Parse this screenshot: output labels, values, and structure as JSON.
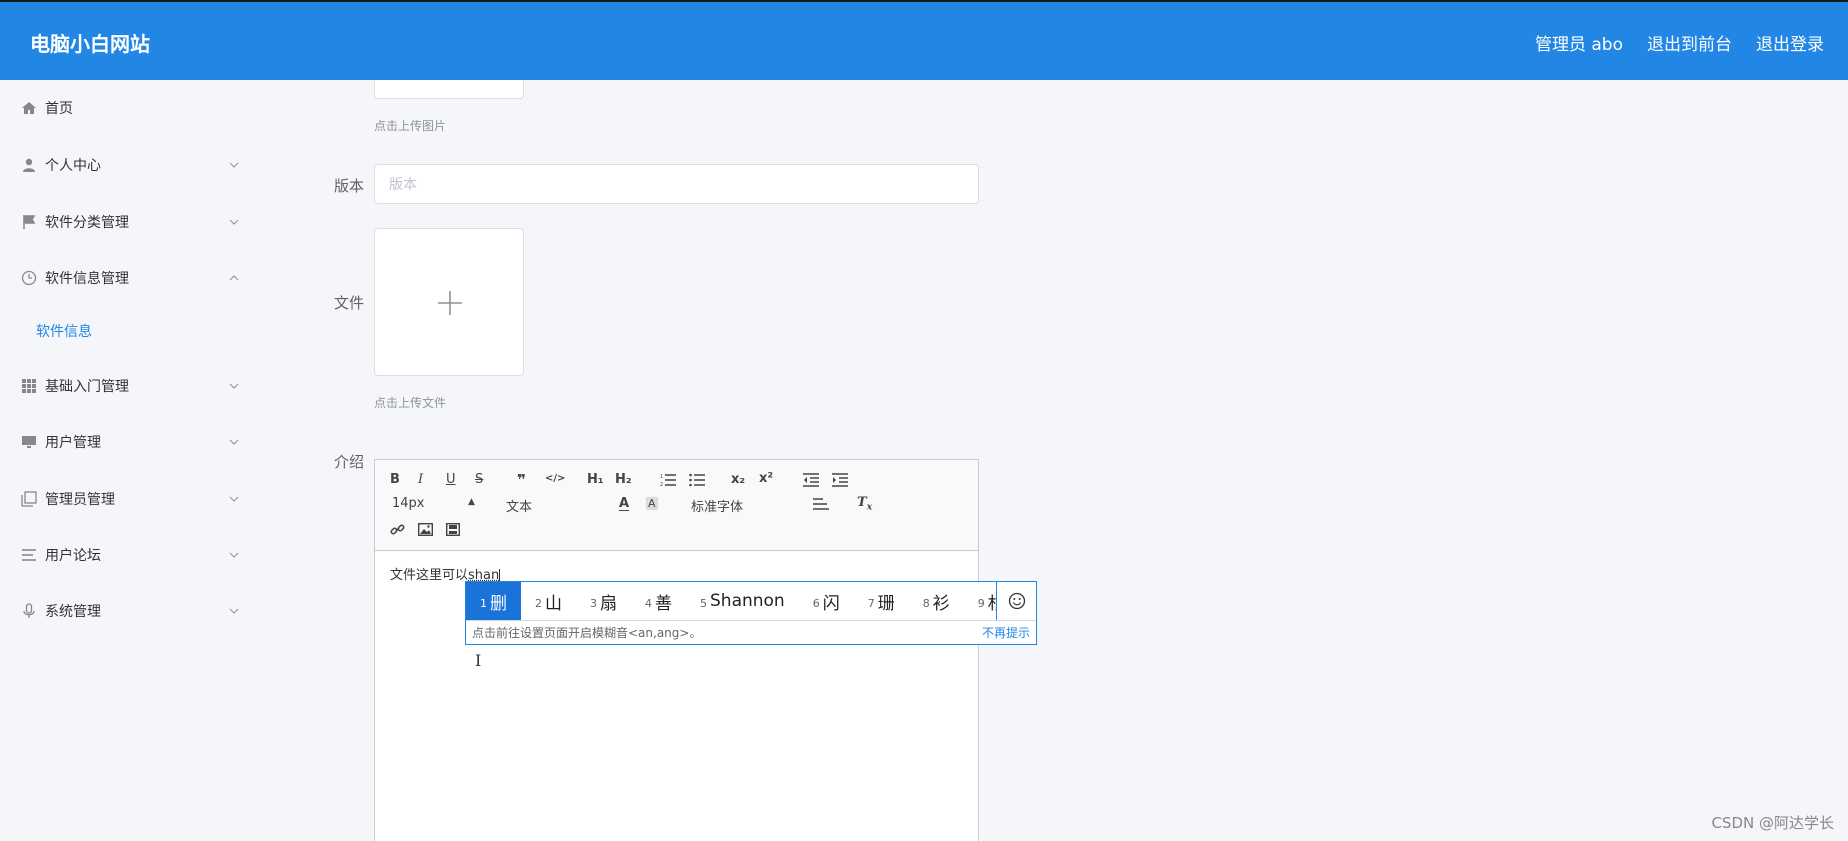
{
  "header": {
    "logo": "电脑小白网站",
    "admin": "管理员 abo",
    "to_front": "退出到前台",
    "logout": "退出登录"
  },
  "sidebar": {
    "items": [
      {
        "label": "首页",
        "icon": "home-icon"
      },
      {
        "label": "个人中心",
        "icon": "user-icon"
      },
      {
        "label": "软件分类管理",
        "icon": "flag-icon"
      },
      {
        "label": "软件信息管理",
        "icon": "clock-icon"
      },
      {
        "label": "基础入门管理",
        "icon": "grid-icon"
      },
      {
        "label": "用户管理",
        "icon": "monitor-icon"
      },
      {
        "label": "管理员管理",
        "icon": "copy-icon"
      },
      {
        "label": "用户论坛",
        "icon": "list-icon"
      },
      {
        "label": "系统管理",
        "icon": "mic-icon"
      }
    ],
    "sub_item": "软件信息"
  },
  "form": {
    "image_hint": "点击上传图片",
    "version_label": "版本",
    "version_placeholder": "版本",
    "file_label": "文件",
    "file_hint": "点击上传文件",
    "intro_label": "介绍"
  },
  "editor": {
    "toolbar": {
      "bold": "B",
      "italic": "I",
      "underline": "U",
      "strike": "S",
      "quote": "❞",
      "code": "</>",
      "h1": "H₁",
      "h2": "H₂",
      "sub": "x₂",
      "sup": "x²",
      "font_size": "14px",
      "block_type": "文本",
      "font_family": "标准字体",
      "color": "A",
      "bg_color": "A",
      "clear": "T"
    },
    "content": "文件这里可以",
    "typed": "shan"
  },
  "ime": {
    "candidates": [
      {
        "num": "1",
        "text": "删"
      },
      {
        "num": "2",
        "text": "山"
      },
      {
        "num": "3",
        "text": "扇"
      },
      {
        "num": "4",
        "text": "善"
      },
      {
        "num": "5",
        "text": "Shannon"
      },
      {
        "num": "6",
        "text": "闪"
      },
      {
        "num": "7",
        "text": "珊"
      },
      {
        "num": "8",
        "text": "衫"
      },
      {
        "num": "9",
        "text": "杉"
      }
    ],
    "tip": "点击前往设置页面开启模糊音<an,ang>。",
    "no_more": "不再提示"
  },
  "watermark": "CSDN @阿达学长",
  "colors": {
    "primary": "#2287e4",
    "bg": "#f4f6f9"
  }
}
